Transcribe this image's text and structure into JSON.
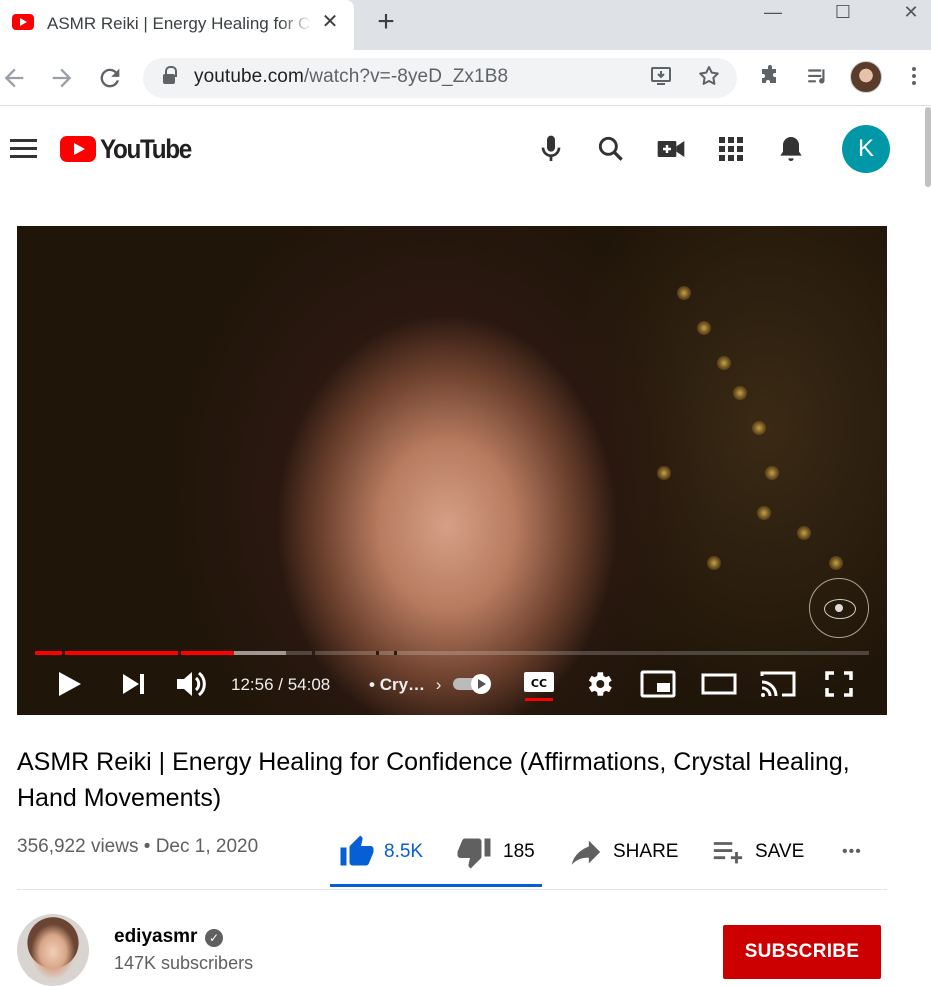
{
  "browser": {
    "tab_title": "ASMR Reiki | Energy Healing for Confidence (Affirmations, Crystal Healing, Hand Movements) - YouTube",
    "tab_close": "✕",
    "new_tab": "+",
    "window_minimize": "—",
    "window_maximize": "☐",
    "window_close": "✕",
    "url_domain": "youtube.com",
    "url_path": "/watch?v=-8yeD_Zx1B8"
  },
  "youtube_header": {
    "logo_text": "YouTube",
    "account_initial": "K"
  },
  "player": {
    "time": "12:56 / 54:08",
    "chapter_sep": "•",
    "chapter": "Cry…",
    "chapter_chevron": "›",
    "played_fraction": 0.239,
    "buffered_fraction": 0.301,
    "colors": {
      "played": "#ff0000",
      "buffered": "rgba(255,255,255,0.45)",
      "unplayed": "rgba(255,255,255,0.2)"
    }
  },
  "video": {
    "title": "ASMR Reiki | Energy Healing for Confidence (Affirmations, Crystal Healing, Hand Movements)",
    "views": "356,922 views",
    "date_sep": "•",
    "date": "Dec 1, 2020",
    "likes": "8.5K",
    "dislikes": "185",
    "share_label": "SHARE",
    "save_label": "SAVE",
    "more_label": "•••"
  },
  "channel": {
    "name": "ediyasmr",
    "verified_mark": "✓",
    "subscribers": "147K subscribers",
    "subscribe_label": "SUBSCRIBE"
  },
  "colors": {
    "like_blue": "#065fd4",
    "subscribe_red": "#cc0000",
    "youtube_red": "#ff0000",
    "avatar_teal": "#0097a7"
  }
}
